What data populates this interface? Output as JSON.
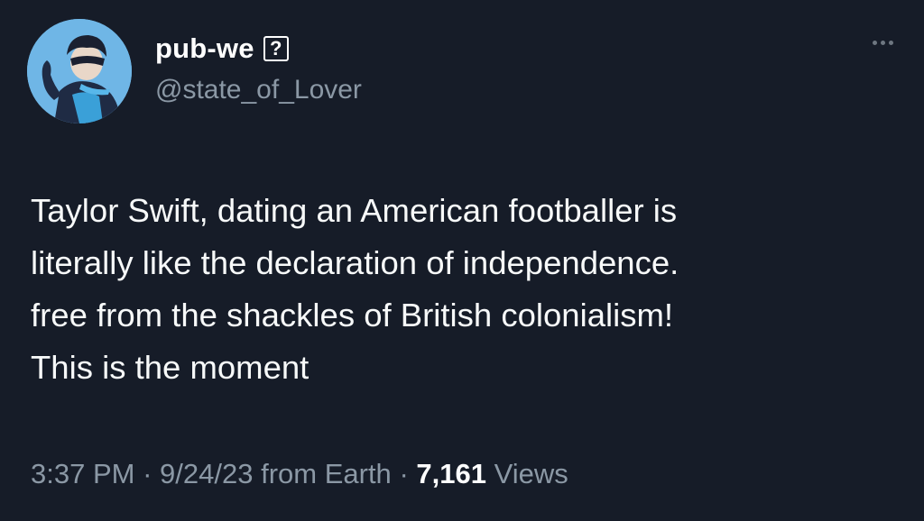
{
  "author": {
    "display_name": "pub-we",
    "badge": "?",
    "handle": "@state_of_Lover"
  },
  "menu": {
    "icon": "more-horizontal-icon"
  },
  "tweet": {
    "lines": [
      "Taylor Swift, dating an American footballer is",
      "literally like the declaration of independence.",
      "free from the shackles of British colonialism!",
      "This is the moment"
    ]
  },
  "meta": {
    "time": "3:37 PM",
    "separator": "·",
    "date": "9/24/23",
    "source": "from Earth",
    "views_count": "7,161",
    "views_label": "Views"
  },
  "colors": {
    "background": "#161c28",
    "text_primary": "#f7f9f9",
    "text_secondary": "#8b98a5",
    "avatar_bg": "#6fb6e6"
  }
}
